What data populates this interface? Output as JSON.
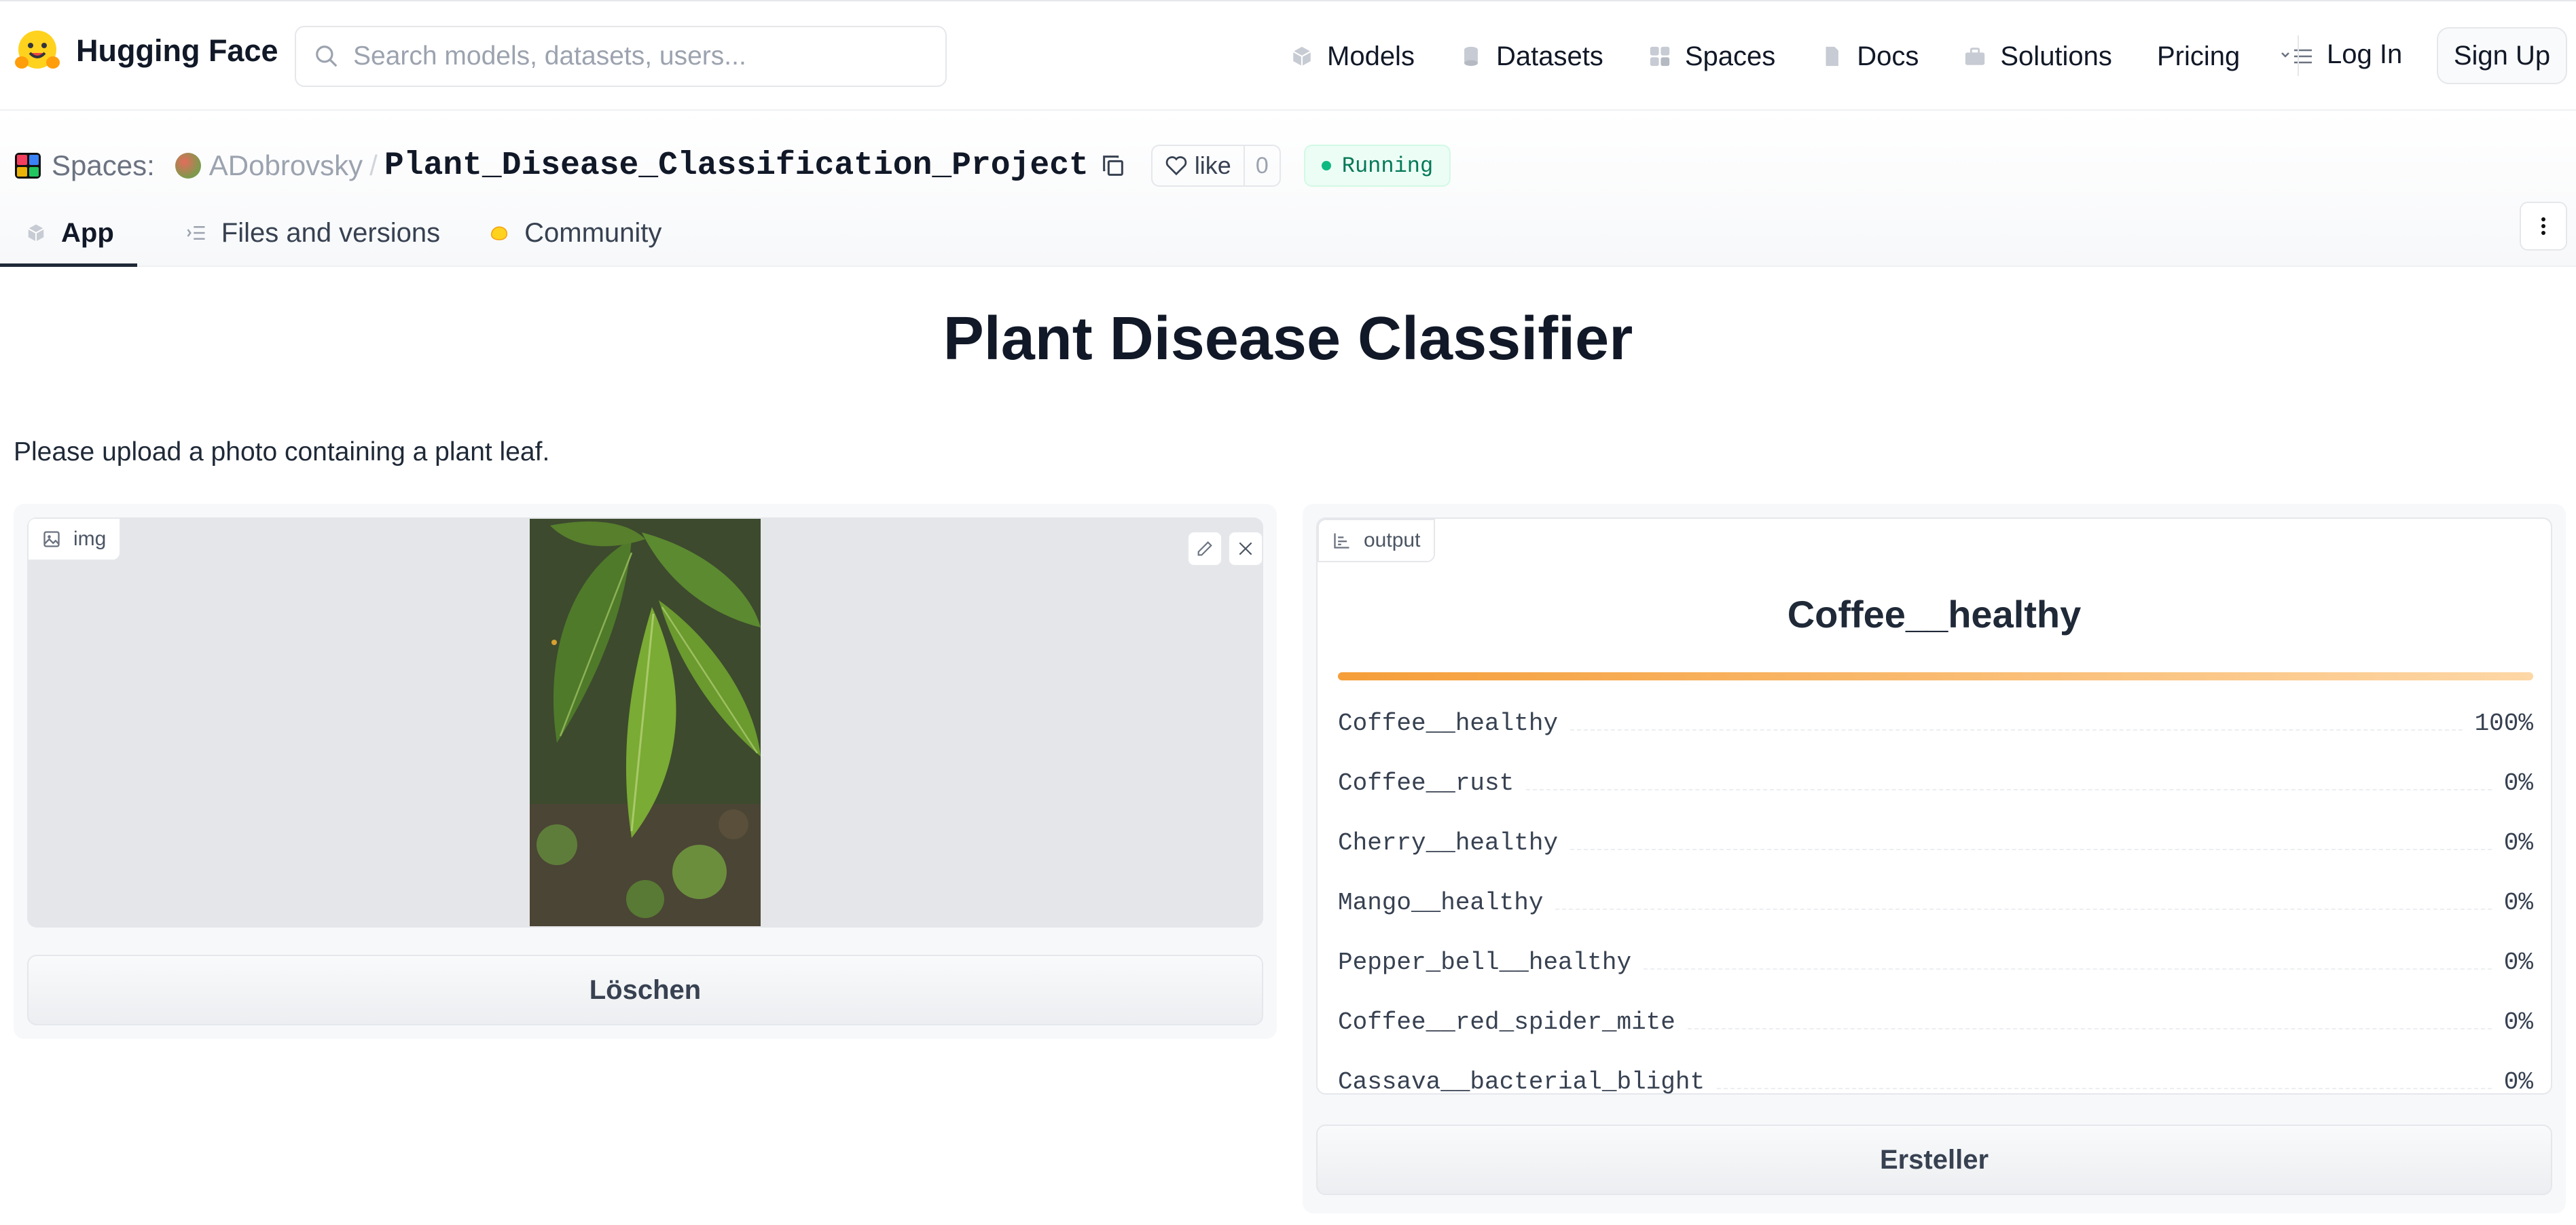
{
  "navbar": {
    "brand": "Hugging Face",
    "search_placeholder": "Search models, datasets, users...",
    "links": [
      {
        "label": "Models",
        "icon": "models-icon"
      },
      {
        "label": "Datasets",
        "icon": "datasets-icon"
      },
      {
        "label": "Spaces",
        "icon": "spaces-icon"
      },
      {
        "label": "Docs",
        "icon": "docs-icon"
      },
      {
        "label": "Solutions",
        "icon": "solutions-icon"
      }
    ],
    "pricing": "Pricing",
    "login": "Log In",
    "signup": "Sign Up"
  },
  "space": {
    "spaces_label": "Spaces:",
    "owner": "ADobrovsky",
    "separator": "/",
    "repo": "Plant_Disease_Classification_Project",
    "like_label": "like",
    "like_count": "0",
    "status": "Running",
    "status_color": "#10b981"
  },
  "tabs": [
    {
      "label": "App",
      "active": true
    },
    {
      "label": "Files and versions",
      "active": false
    },
    {
      "label": "Community",
      "active": false
    }
  ],
  "app": {
    "title": "Plant Disease Classifier",
    "description": "Please upload a photo containing a plant leaf.",
    "input": {
      "label": "img",
      "clear_button": "Löschen"
    },
    "output": {
      "label": "output",
      "predicted": "Coffee__healthy",
      "confidences": [
        {
          "label": "Coffee__healthy",
          "value": "100%"
        },
        {
          "label": "Coffee__rust",
          "value": "0%"
        },
        {
          "label": "Cherry__healthy",
          "value": "0%"
        },
        {
          "label": "Mango__healthy",
          "value": "0%"
        },
        {
          "label": "Pepper_bell__healthy",
          "value": "0%"
        },
        {
          "label": "Coffee__red_spider_mite",
          "value": "0%"
        },
        {
          "label": "Cassava__bacterial_blight",
          "value": "0%"
        }
      ],
      "top_confidence_fraction": 1.0,
      "bar_color": "#f59e3a",
      "submit_button": "Ersteller"
    }
  }
}
